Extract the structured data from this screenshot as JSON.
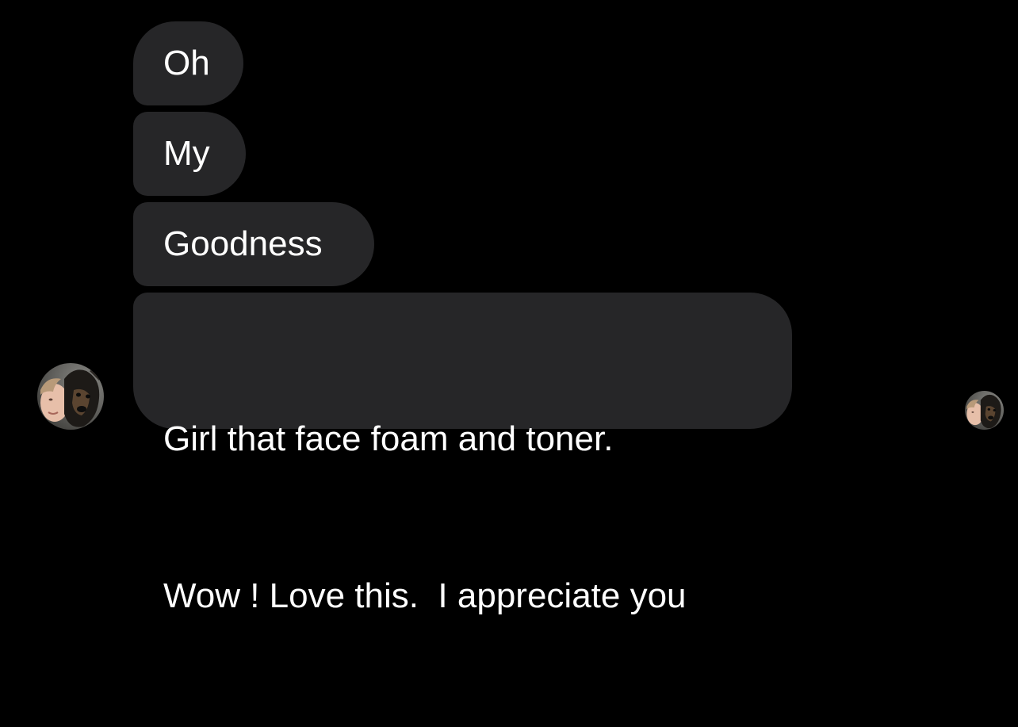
{
  "messages": [
    {
      "text": "Oh"
    },
    {
      "text": "My"
    },
    {
      "text": "Goodness"
    },
    {
      "lines": [
        "Girl that face foam and toner.",
        "Wow ! Love this.  I appreciate you"
      ]
    }
  ],
  "avatars": {
    "sender": {
      "icon": "contact-avatar-photo"
    },
    "read_receipt": {
      "icon": "read-receipt-avatar-photo"
    }
  },
  "colors": {
    "background": "#000000",
    "bubble": "#262628",
    "text": "#ffffff"
  }
}
